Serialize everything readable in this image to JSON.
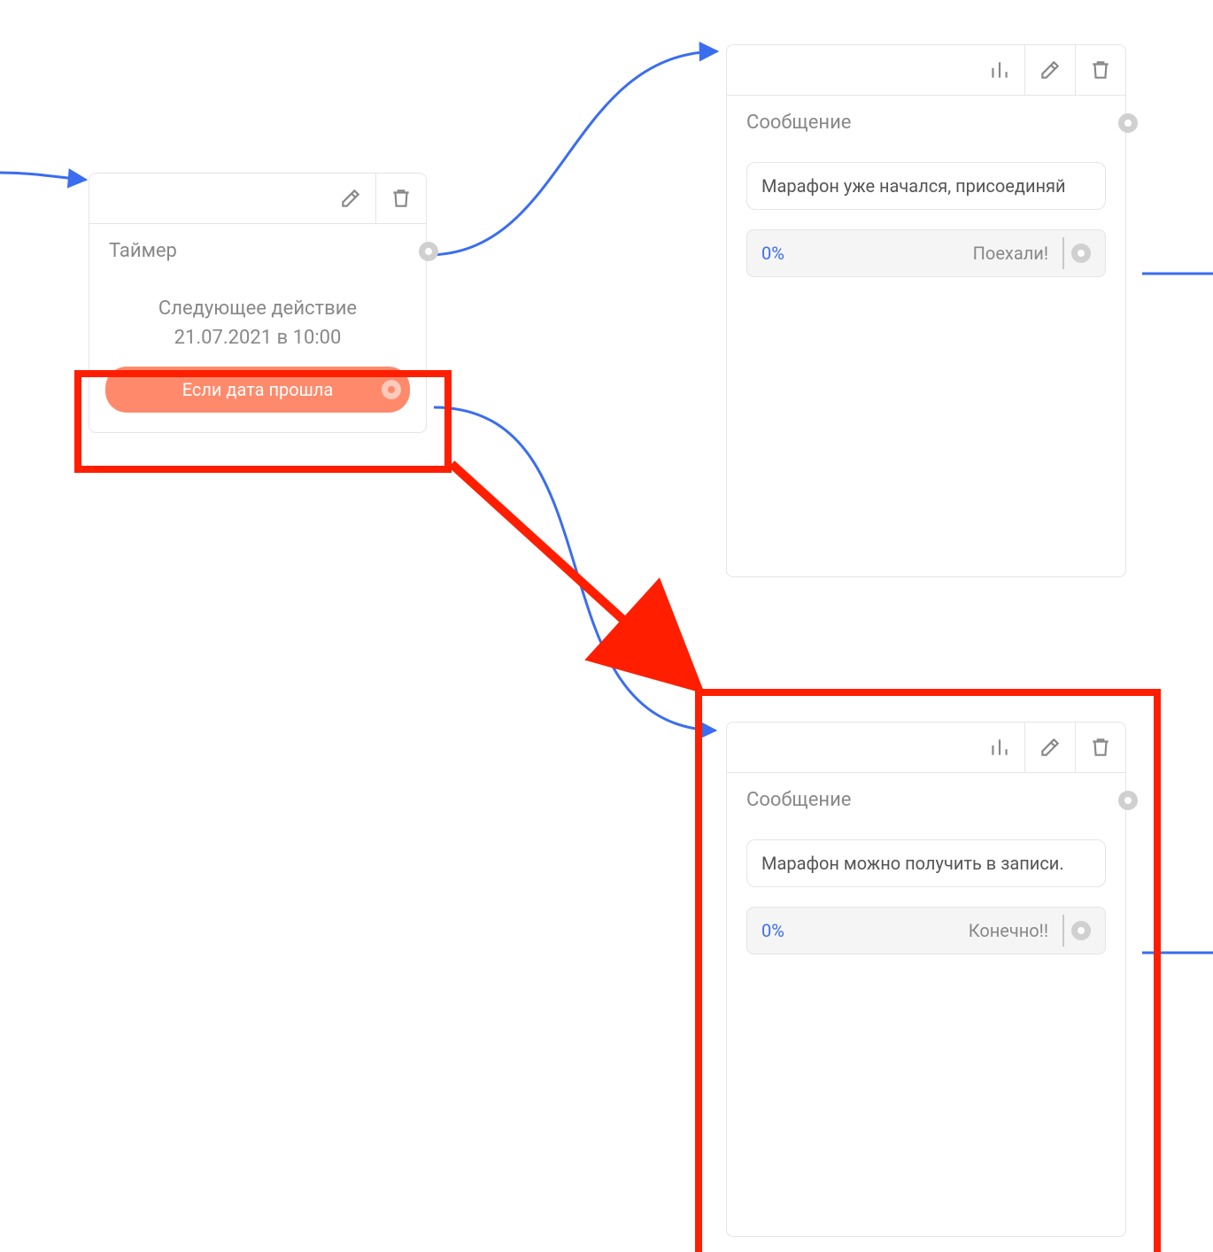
{
  "colors": {
    "highlight": "#ff1e00",
    "wire": "#3a6df0",
    "pill": "#ff8a6b"
  },
  "timerNode": {
    "title": "Таймер",
    "description_line1": "Следующее действие",
    "description_line2": "21.07.2021 в 10:00",
    "condition_label": "Если дата прошла"
  },
  "messageNode1": {
    "title": "Сообщение",
    "bubble_text": "Марафон уже начался, присоединяй",
    "button_percent": "0%",
    "button_label": "Поехали!"
  },
  "messageNode2": {
    "title": "Сообщение",
    "bubble_text": "Марафон можно получить в записи.",
    "button_percent": "0%",
    "button_label": "Конечно!!"
  },
  "icons": {
    "stats": "stats-icon",
    "edit": "edit-icon",
    "delete": "delete-icon"
  }
}
